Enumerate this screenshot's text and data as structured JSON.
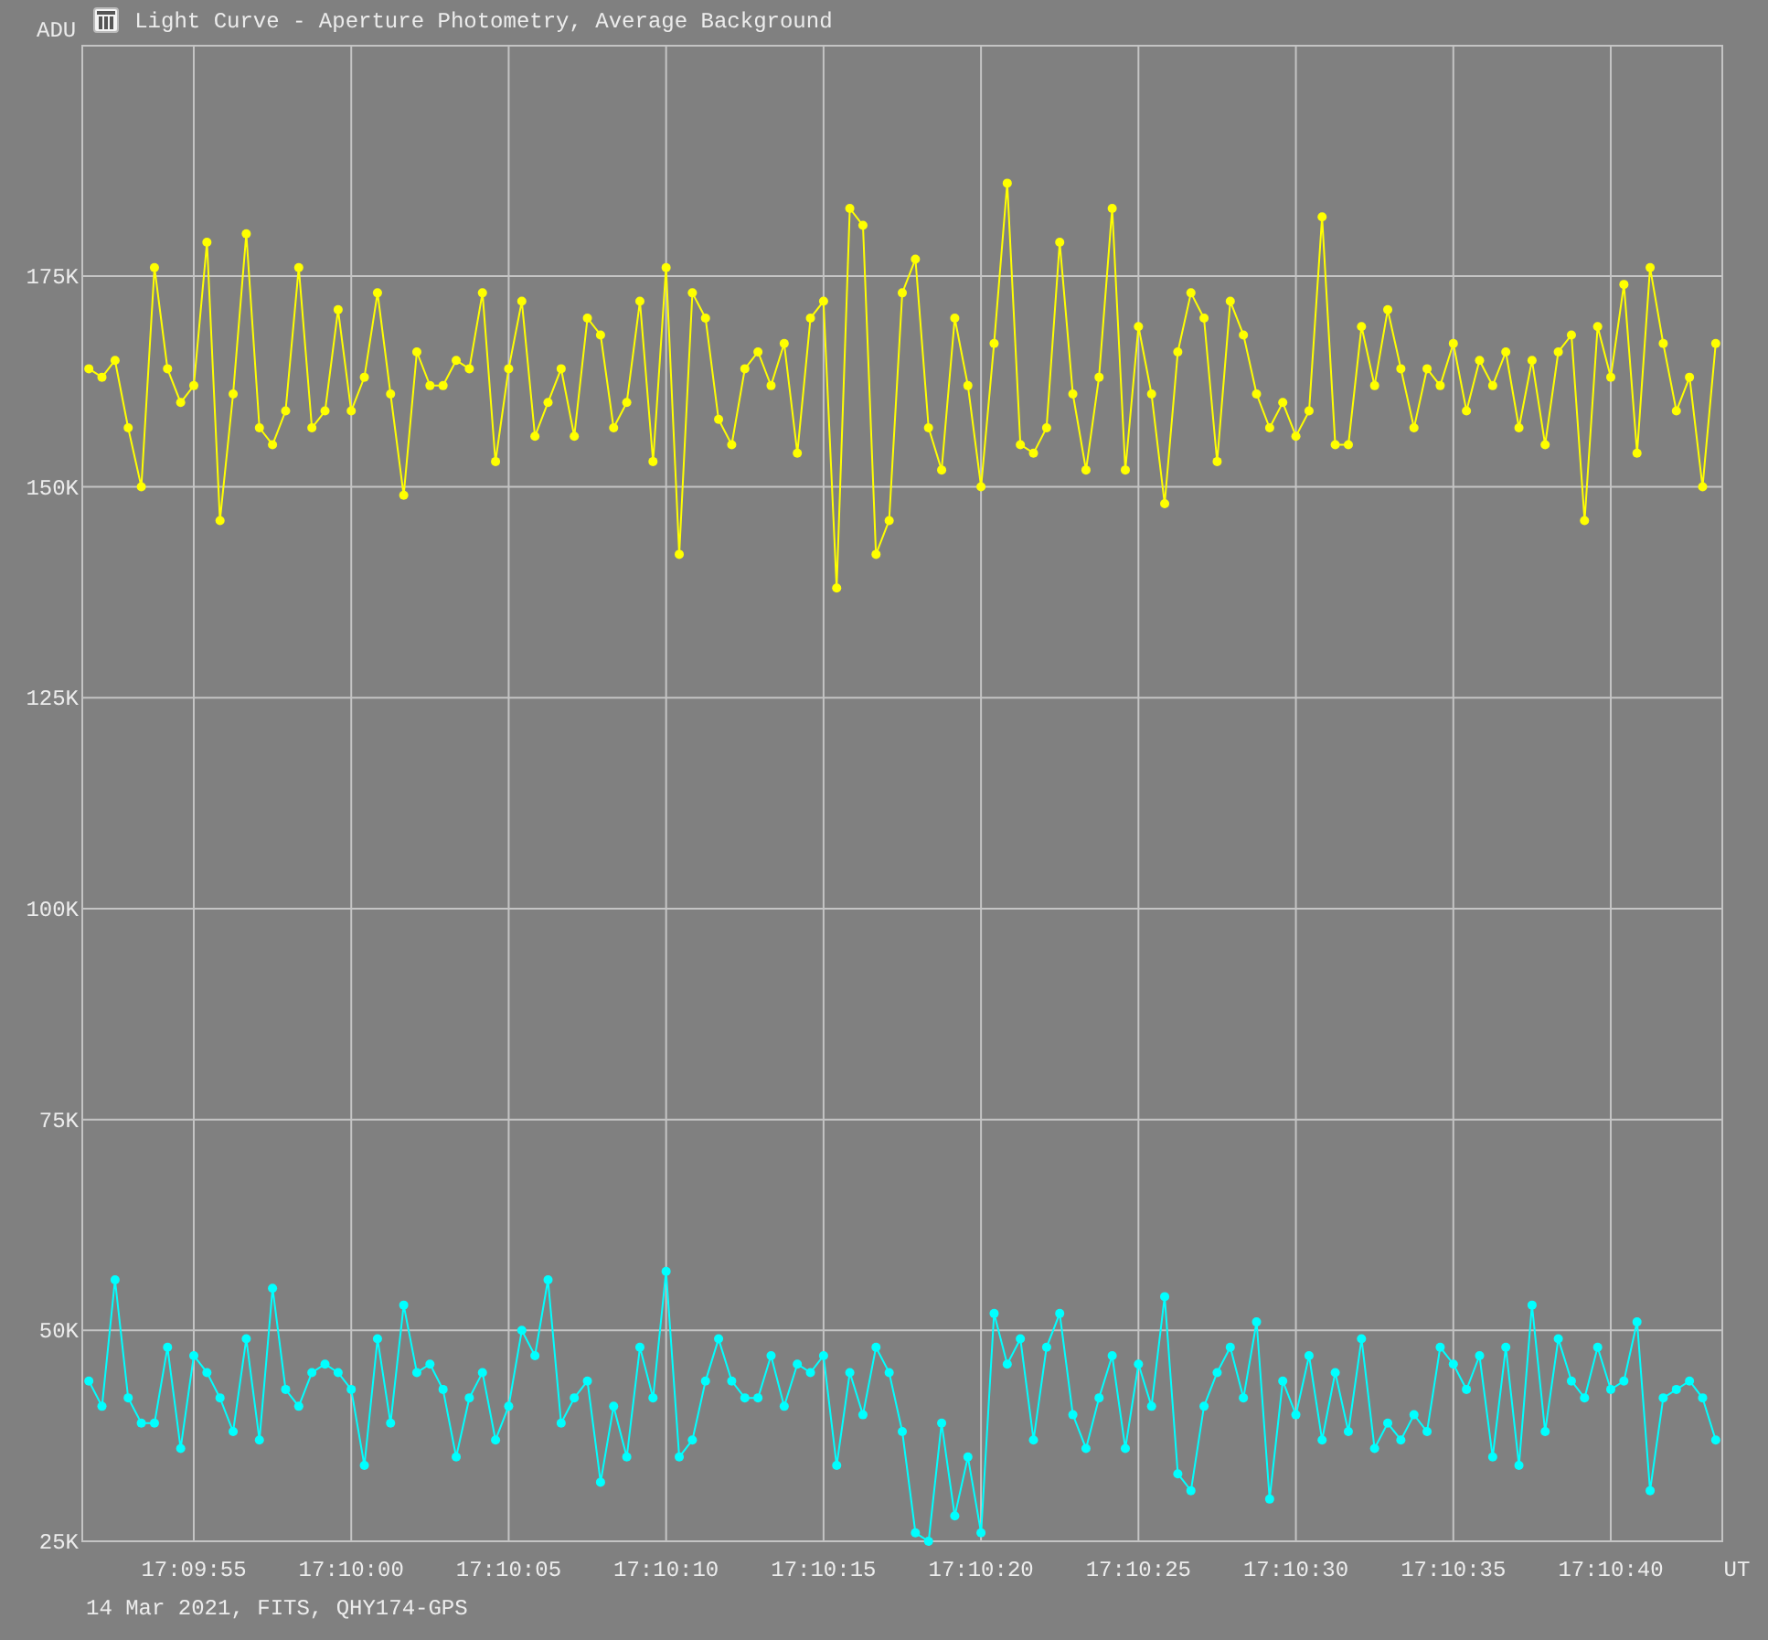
{
  "window": {
    "title": "Light Curve - Aperture Photometry, Average Background"
  },
  "chart": {
    "chart_data": {
      "type": "line",
      "ylabel": "ADU",
      "xlabel": "UT",
      "grid": true,
      "categories": [
        null,
        null,
        null,
        null,
        null,
        null,
        null,
        null,
        "17:09:55",
        null,
        null,
        null,
        null,
        null,
        null,
        null,
        null,
        null,
        null,
        null,
        "17:10:00",
        null,
        null,
        null,
        null,
        null,
        null,
        null,
        null,
        null,
        null,
        null,
        "17:10:05",
        null,
        null,
        null,
        null,
        null,
        null,
        null,
        null,
        null,
        null,
        null,
        "17:10:10",
        null,
        null,
        null,
        null,
        null,
        null,
        null,
        null,
        null,
        null,
        null,
        "17:10:15",
        null,
        null,
        null,
        null,
        null,
        null,
        null,
        null,
        null,
        null,
        null,
        "17:10:20",
        null,
        null,
        null,
        null,
        null,
        null,
        null,
        null,
        null,
        null,
        null,
        "17:10:25",
        null,
        null,
        null,
        null,
        null,
        null,
        null,
        null,
        null,
        null,
        null,
        "17:10:30",
        null,
        null,
        null,
        null,
        null,
        null,
        null,
        null,
        null,
        null,
        null,
        "17:10:35",
        null,
        null,
        null,
        null,
        null,
        null,
        null,
        null,
        null,
        null,
        null,
        "17:10:40",
        null,
        null,
        null,
        null,
        null,
        null,
        null,
        null
      ],
      "ylim": [
        25,
        202.3
      ],
      "yticks": [
        {
          "value": 25,
          "label": "25K"
        },
        {
          "value": 50,
          "label": "50K"
        },
        {
          "value": 75,
          "label": "75K"
        },
        {
          "value": 100,
          "label": "100K"
        },
        {
          "value": 125,
          "label": "125K"
        },
        {
          "value": 150,
          "label": "150K"
        },
        {
          "value": 175,
          "label": "175K"
        }
      ],
      "series": [
        {
          "color": "#ffff00",
          "marker": "circle",
          "values": [
            164,
            163,
            165,
            157,
            150,
            176,
            164,
            160,
            162,
            179,
            146,
            161,
            180,
            157,
            155,
            159,
            176,
            157,
            159,
            171,
            159,
            163,
            173,
            161,
            149,
            166,
            162,
            162,
            165,
            164,
            173,
            153,
            164,
            172,
            156,
            160,
            164,
            156,
            170,
            168,
            157,
            160,
            172,
            153,
            176,
            142,
            173,
            170,
            158,
            155,
            164,
            166,
            162,
            167,
            154,
            170,
            172,
            138,
            183,
            181,
            142,
            146,
            173,
            177,
            157,
            152,
            170,
            162,
            150,
            167,
            186,
            155,
            154,
            157,
            179,
            161,
            152,
            163,
            183,
            152,
            169,
            161,
            148,
            166,
            173,
            170,
            153,
            172,
            168,
            161,
            157,
            160,
            156,
            159,
            182,
            155,
            155,
            169,
            162,
            171,
            164,
            157,
            164,
            162,
            167,
            159,
            165,
            162,
            166,
            157,
            165,
            155,
            166,
            168,
            146,
            169,
            163,
            174,
            154,
            176,
            167,
            159,
            163,
            150,
            167
          ]
        },
        {
          "color": "#00ffff",
          "marker": "circle",
          "values": [
            44,
            41,
            56,
            42,
            39,
            39,
            48,
            36,
            47,
            45,
            42,
            38,
            49,
            37,
            55,
            43,
            41,
            45,
            46,
            45,
            43,
            34,
            49,
            39,
            53,
            45,
            46,
            43,
            35,
            42,
            45,
            37,
            41,
            50,
            47,
            56,
            39,
            42,
            44,
            32,
            41,
            35,
            48,
            42,
            57,
            35,
            37,
            44,
            49,
            44,
            42,
            42,
            47,
            41,
            46,
            45,
            47,
            34,
            45,
            40,
            48,
            45,
            38,
            26,
            25,
            39,
            28,
            35,
            26,
            52,
            46,
            49,
            37,
            48,
            52,
            40,
            36,
            42,
            47,
            36,
            46,
            41,
            54,
            33,
            31,
            41,
            45,
            48,
            42,
            51,
            30,
            44,
            40,
            47,
            37,
            45,
            38,
            49,
            36,
            39,
            37,
            40,
            38,
            48,
            46,
            43,
            47,
            35,
            48,
            34,
            53,
            38,
            49,
            44,
            42,
            48,
            43,
            44,
            51,
            31,
            42,
            43,
            44,
            42,
            37
          ]
        }
      ]
    }
  },
  "footer": "14 Mar 2021, FITS, QHY174-GPS"
}
